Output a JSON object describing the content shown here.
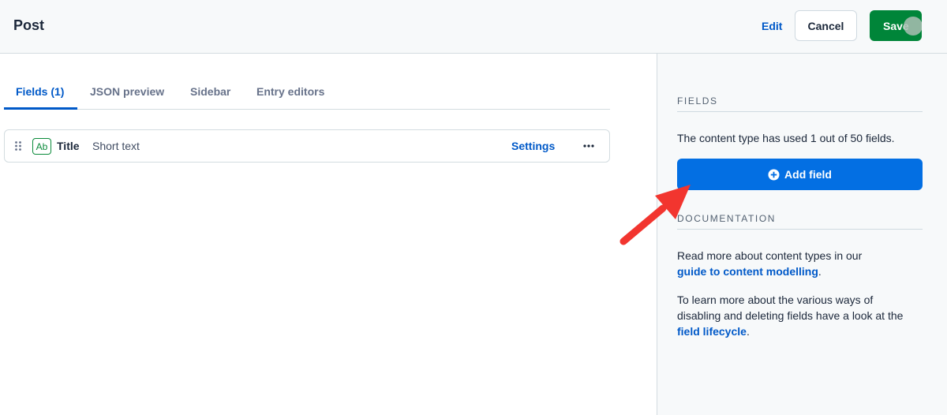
{
  "header": {
    "title": "Post",
    "edit_label": "Edit",
    "cancel_label": "Cancel",
    "save_label": "Save"
  },
  "tabs": [
    {
      "label": "Fields (1)",
      "active": true
    },
    {
      "label": "JSON preview",
      "active": false
    },
    {
      "label": "Sidebar",
      "active": false
    },
    {
      "label": "Entry editors",
      "active": false
    }
  ],
  "fields": [
    {
      "icon_label": "Ab",
      "name": "Title",
      "type": "Short text",
      "settings_label": "Settings"
    }
  ],
  "sidebar": {
    "fields_heading": "FIELDS",
    "usage_text": "The content type has used 1 out of 50 fields.",
    "add_field_label": "Add field",
    "documentation_heading": "DOCUMENTATION",
    "doc_text_1": "Read more about content types in our",
    "doc_link_1": "guide to content modelling",
    "doc_text_1_end": ".",
    "doc_text_2": "To learn more about the various ways of disabling and deleting fields have a look at the",
    "doc_link_2": "field lifecycle",
    "doc_text_2_end": "."
  },
  "icons": {
    "drag": "drag-handle-icon",
    "more": "more-horizontal-icon",
    "add": "plus-circle-icon",
    "annotation": "red-arrow-annotation"
  },
  "colors": {
    "accent_blue": "#036fe3",
    "link_blue": "#0059c8",
    "save_green": "#008539",
    "annotation_red": "#f2352f"
  }
}
